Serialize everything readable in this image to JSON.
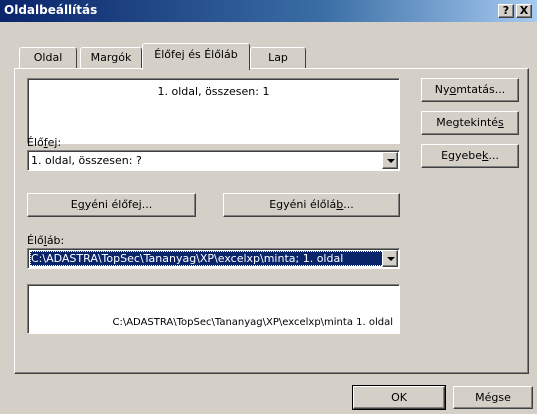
{
  "window": {
    "title": "Oldalbeállítás",
    "help_button": "?",
    "close_button": "X"
  },
  "tabs": [
    {
      "label": "Oldal"
    },
    {
      "label": "Margók"
    },
    {
      "label": "Élőfej és Élőláb"
    },
    {
      "label": "Lap"
    }
  ],
  "header": {
    "preview_text": "1. oldal, összesen: 1",
    "label_pre": "Élő",
    "label_u": "f",
    "label_post": "ej:",
    "selected_value": "1. oldal, összesen: ?",
    "custom_header_pre": "E",
    "custom_header_u": "g",
    "custom_header_post": "yéni élőfej..."
  },
  "footer": {
    "custom_footer_pre": "Egyéni élőlá",
    "custom_footer_u": "b",
    "custom_footer_post": "...",
    "label_pre": "Élő",
    "label_u": "l",
    "label_post": "áb:",
    "selected_value": "C:\\ADASTRA\\TopSec\\Tananyag\\XP\\excelxp\\minta; 1. oldal",
    "preview_text": "C:\\ADASTRA\\TopSec\\Tananyag\\XP\\excelxp\\minta 1. oldal"
  },
  "side_buttons": {
    "print_pre": "Ny",
    "print_u": "o",
    "print_post": "mtatás...",
    "preview_pre": "Megtekinté",
    "preview_u": "s",
    "preview_post": "",
    "options_pre": "Egyebe",
    "options_u": "k",
    "options_post": "..."
  },
  "dialog_buttons": {
    "ok": "OK",
    "cancel": "Mégse"
  }
}
